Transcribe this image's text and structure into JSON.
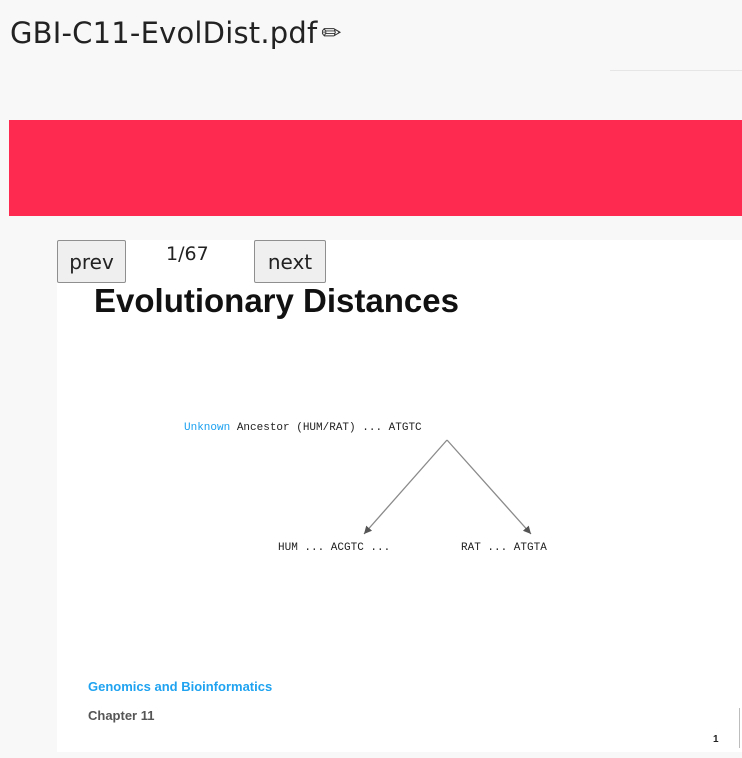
{
  "header": {
    "file_name": "GBI-C11-EvolDist.pdf",
    "edit_icon": "pencil-icon"
  },
  "colors": {
    "banner": "#ff2a4f",
    "accent_text": "#1aa0f0"
  },
  "viewer": {
    "prev_label": "prev",
    "next_label": "next",
    "page_indicator": "1/67"
  },
  "slide": {
    "title": "Evolutionary Distances",
    "ancestor_unknown": "Unknown",
    "ancestor_rest": " Ancestor (HUM/RAT) ... ATGTC",
    "hum_sequence": "HUM ... ACGTC ...",
    "rat_sequence": "RAT ... ATGTA",
    "course": "Genomics and Bioinformatics",
    "chapter": "Chapter 11",
    "number": "1"
  }
}
